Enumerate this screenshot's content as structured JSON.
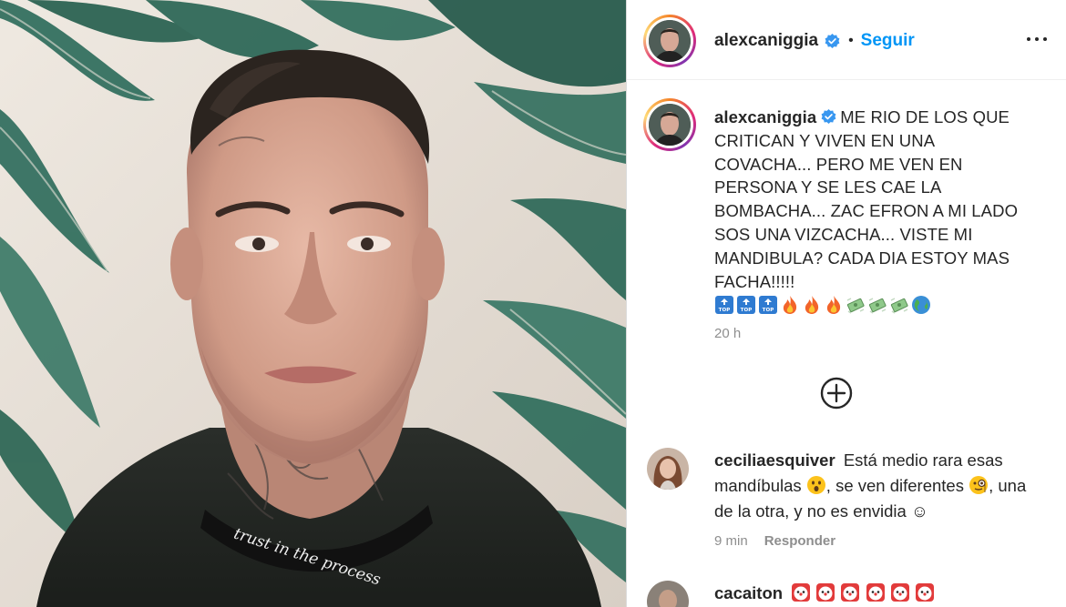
{
  "post": {
    "author": "alexcaniggia",
    "follow_label": "Seguir",
    "separator": "•",
    "caption": "ME RIO DE LOS QUE CRITICAN Y VIVEN EN UNA COVACHA... PERO ME VEN EN PERSONA Y SE LES CAE LA BOMBACHA... ZAC EFRON A MI LADO SOS UNA VIZCACHA... VISTE MI MANDIBULA? CADA DIA ESTOY MAS FACHA!!!!!",
    "caption_emojis": [
      "top-arrow-emoji",
      "top-arrow-emoji",
      "top-arrow-emoji",
      "fire-emoji",
      "fire-emoji",
      "fire-emoji",
      "money-emoji",
      "money-emoji",
      "money-emoji",
      "globe-emoji"
    ],
    "time_ago": "20 h",
    "photo_shirt_text": "trust in the process"
  },
  "comments": [
    {
      "username": "ceciliaesquiver",
      "text_part1": "Está medio rara esas mandíbulas",
      "text_part2": ", se ven diferentes",
      "text_part3": ", una de la otra, y no es envidia ☺",
      "emoji1": "astonished-face-emoji",
      "emoji2": "face-with-monocle-emoji",
      "time": "9 min",
      "reply_label": "Responder"
    },
    {
      "username": "cacaiton",
      "emojis": [
        "clown-face-emoji",
        "clown-face-emoji",
        "clown-face-emoji",
        "clown-face-emoji",
        "clown-face-emoji",
        "clown-face-emoji"
      ]
    }
  ],
  "colors": {
    "link": "#0095f6",
    "text": "#262626",
    "secondary": "#8e8e8e",
    "verified": "#3897f0"
  }
}
